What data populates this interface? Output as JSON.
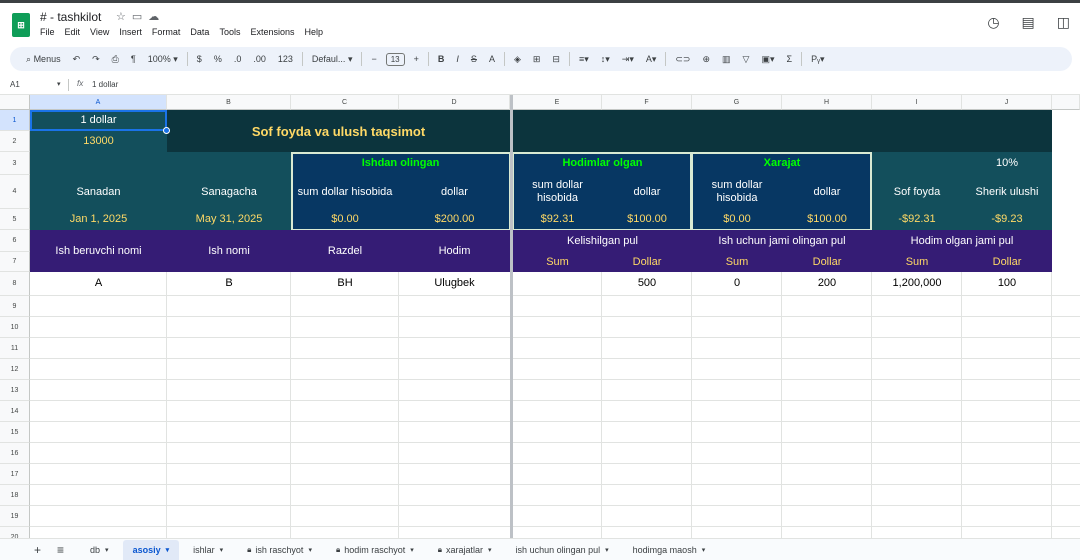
{
  "window": {
    "title": "# - tashkilot"
  },
  "menu": [
    "File",
    "Edit",
    "View",
    "Insert",
    "Format",
    "Data",
    "Tools",
    "Extensions",
    "Help"
  ],
  "toolbar": {
    "menus_label": "Menus",
    "zoom": "100%",
    "currency": "$",
    "percent": "%",
    "dec_less": ".0",
    "dec_more": ".00",
    "num_format": "123",
    "font": "Defaul...",
    "font_size": "13"
  },
  "formula_bar": {
    "cell_ref": "A1",
    "fx": "fx",
    "content": "1 dollar"
  },
  "columns": [
    "A",
    "B",
    "C",
    "D",
    "E",
    "F",
    "G",
    "H",
    "I",
    "J"
  ],
  "rows": [
    "1",
    "2",
    "3",
    "4",
    "5",
    "6",
    "7",
    "8",
    "9",
    "10",
    "11",
    "12",
    "13",
    "14",
    "15",
    "16",
    "17",
    "18",
    "19",
    "20"
  ],
  "sheet": {
    "a1": "1 dollar",
    "a2": "13000",
    "title": "Sof foyda va ulush taqsimot",
    "sec_ishdan": "Ishdan olingan",
    "sec_hodimlar": "Hodimlar olgan",
    "sec_xarajat": "Xarajat",
    "j3": "10%",
    "sanadan": "Sanadan",
    "sanagacha": "Sanagacha",
    "sum_dollar_hisobida": "sum dollar hisobida",
    "dollar": "dollar",
    "sof_foyda": "Sof foyda",
    "sherik_ulushi": "Sherik ulushi",
    "date_from": "Jan 1, 2025",
    "date_to": "May 31, 2025",
    "c5": "$0.00",
    "d5": "$200.00",
    "e5": "$92.31",
    "f5": "$100.00",
    "g5": "$0.00",
    "h5": "$100.00",
    "i5": "-$92.31",
    "j5": "-$9.23",
    "ish_beruvchi": "Ish beruvchi nomi",
    "ish_nomi": "Ish nomi",
    "razdel": "Razdel",
    "hodim": "Hodim",
    "kelishilgan": "Kelishilgan pul",
    "ish_uchun": "Ish uchun jami olingan pul",
    "hodim_olgan": "Hodim olgan jami pul",
    "sum": "Sum",
    "dollar_cap": "Dollar",
    "row8": [
      "A",
      "B",
      "BH",
      "Ulugbek",
      "",
      "500",
      "0",
      "200",
      "1,200,000",
      "100"
    ]
  },
  "tabs": [
    {
      "label": "db",
      "locked": false,
      "active": false
    },
    {
      "label": "asosiy",
      "locked": false,
      "active": true
    },
    {
      "label": "ishlar",
      "locked": false,
      "active": false
    },
    {
      "label": "ish raschyot",
      "locked": true,
      "active": false
    },
    {
      "label": "hodim raschyot",
      "locked": true,
      "active": false
    },
    {
      "label": "xarajatlar",
      "locked": true,
      "active": false
    },
    {
      "label": "ish uchun olingan pul",
      "locked": false,
      "active": false
    },
    {
      "label": "hodimga maosh",
      "locked": false,
      "active": false
    }
  ],
  "colors": {
    "teal": "#134f5c",
    "dark_teal": "#0c343d",
    "navy": "#073763",
    "purple": "#351c75",
    "yellow": "#ffd966",
    "green": "#00ff00"
  }
}
